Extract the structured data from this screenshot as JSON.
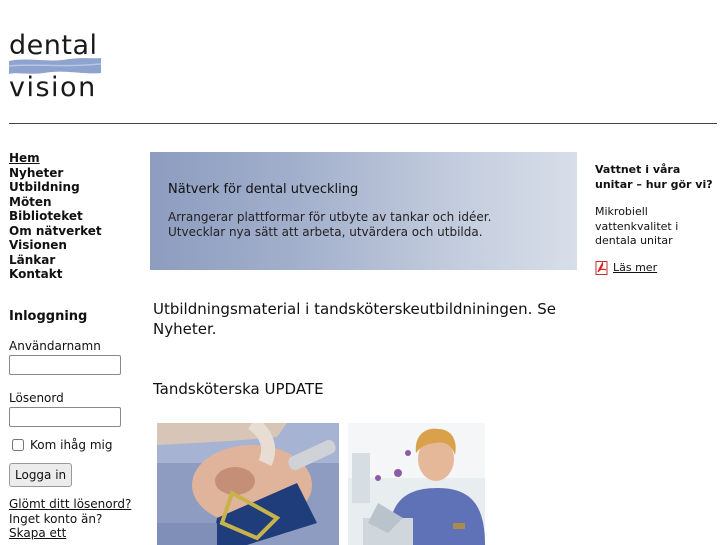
{
  "logo": {
    "line1": "dental",
    "line2": "vision",
    "wave_color": "#8fa3cf"
  },
  "nav": {
    "items": [
      {
        "label": "Hem",
        "active": true
      },
      {
        "label": "Nyheter"
      },
      {
        "label": "Utbildning"
      },
      {
        "label": "Möten"
      },
      {
        "label": "Biblioteket"
      },
      {
        "label": "Om nätverket"
      },
      {
        "label": "Visionen"
      },
      {
        "label": "Länkar"
      },
      {
        "label": "Kontakt"
      }
    ]
  },
  "login": {
    "title": "Inloggning",
    "username_label": "Användarnamn",
    "username_value": "",
    "password_label": "Lösenord",
    "password_value": "",
    "remember_label": "Kom ihåg mig",
    "submit_label": "Logga in",
    "forgot_label": "Glömt ditt lösenord?",
    "no_account_label": "Inget konto än?",
    "create_label": "Skapa ett"
  },
  "banner": {
    "title": "Nätverk för dental utveckling",
    "line1": "Arrangerar plattformar för utbyte av tankar och idéer.",
    "line2": "Utvecklar nya sätt att arbeta, utvärdera och utbilda."
  },
  "main": {
    "headline": "Utbildningsmaterial i tandsköterskeutbildniningen. Se Nyheter.",
    "subhead": "Tandsköterska UPDATE"
  },
  "sidebar": {
    "title": "Vattnet i våra unitar – hur gör vi?",
    "text": "Mikrobiell vattenkvalitet i dentala unitar",
    "more_icon": "pdf-icon",
    "more_label": "Läs mer"
  }
}
